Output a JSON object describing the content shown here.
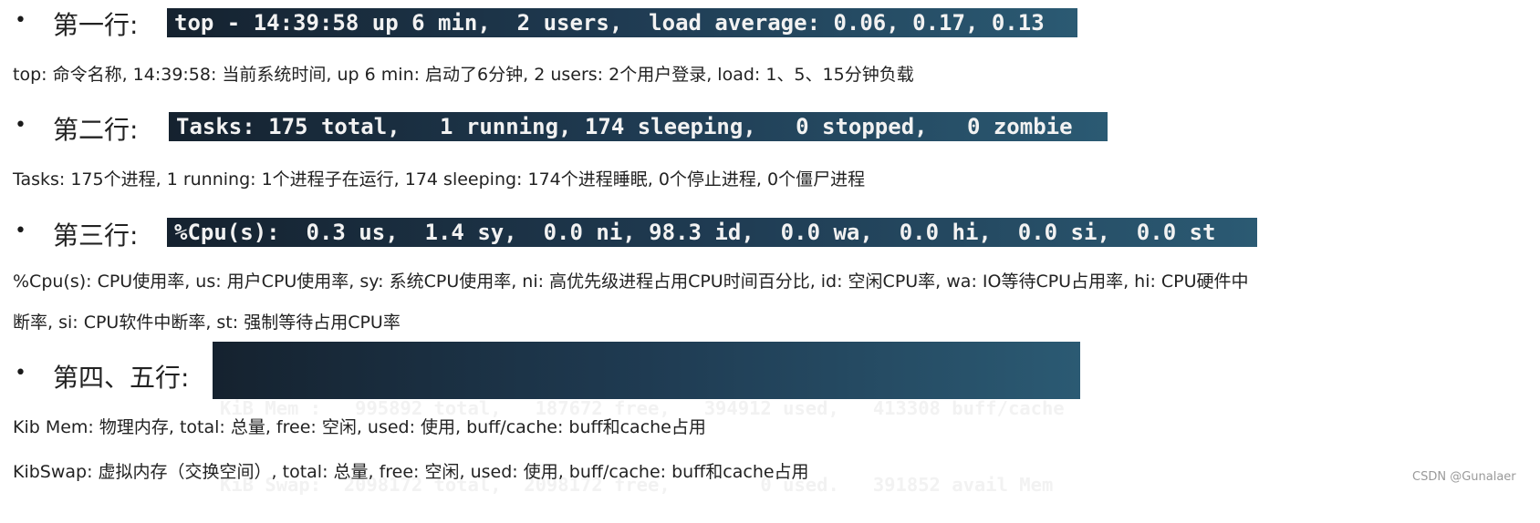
{
  "sections": [
    {
      "label": "第一行:",
      "terminal": [
        "top - 14:39:58 up 6 min,  2 users,  load average: 0.06, 0.17, 0.13"
      ],
      "desc": [
        "top: 命令名称, 14:39:58: 当前系统时间, up 6 min: 启动了6分钟, 2 users: 2个用户登录, load: 1、5、15分钟负载"
      ]
    },
    {
      "label": "第二行:",
      "terminal": [
        "Tasks: 175 total,   1 running, 174 sleeping,   0 stopped,   0 zombie"
      ],
      "desc": [
        "Tasks: 175个进程, 1 running: 1个进程子在运行, 174 sleeping: 174个进程睡眠, 0个停止进程, 0个僵尸进程"
      ]
    },
    {
      "label": "第三行:",
      "terminal": [
        "%Cpu(s):  0.3 us,  1.4 sy,  0.0 ni, 98.3 id,  0.0 wa,  0.0 hi,  0.0 si,  0.0 st"
      ],
      "desc": [
        "%Cpu(s): CPU使用率, us: 用户CPU使用率, sy: 系统CPU使用率, ni: 高优先级进程占用CPU时间百分比, id: 空闲CPU率, wa: IO等待CPU占用率, hi: CPU硬件中",
        "断率, si: CPU软件中断率, st: 强制等待占用CPU率"
      ]
    },
    {
      "label": "第四、五行:",
      "terminal": [
        "KiB Mem :   995892 total,   187672 free,   394912 used,   413308 buff/cache",
        "KiB Swap:  2098172 total,  2098172 free,        0 used.   391852 avail Mem"
      ],
      "desc": [
        "Kib Mem: 物理内存, total: 总量, free: 空闲, used: 使用, buff/cache: buff和cache占用",
        "KibSwap: 虚拟内存（交换空间）, total: 总量, free: 空闲, used: 使用, buff/cache: buff和cache占用"
      ]
    }
  ],
  "bullet": "•",
  "watermark": "CSDN @Gunalaer"
}
